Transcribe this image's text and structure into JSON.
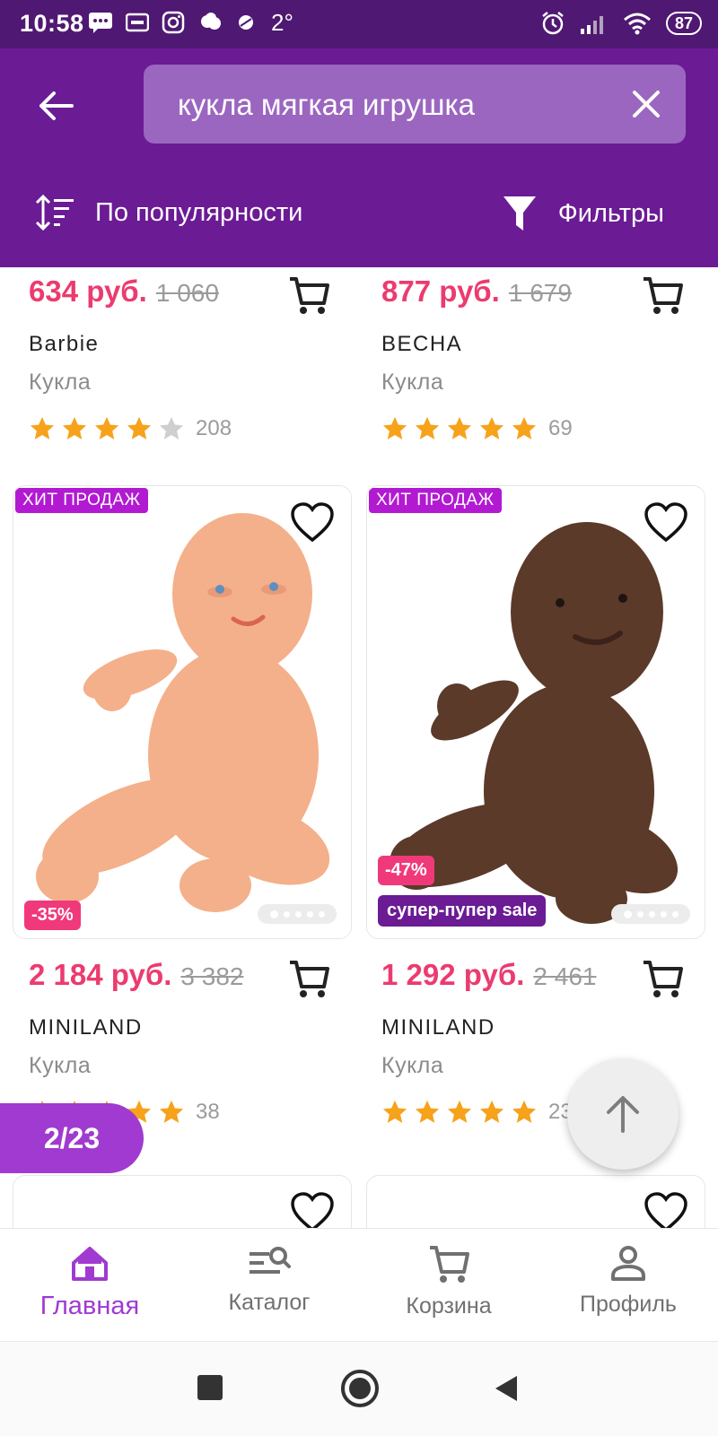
{
  "status_bar": {
    "time": "10:58",
    "temperature": "2°",
    "battery": "87",
    "icons": [
      "message-icon",
      "card-icon",
      "instagram-icon",
      "weather-icon",
      "dot-icon",
      "alarm-icon",
      "signal-icon",
      "wifi-icon"
    ]
  },
  "header": {
    "search": {
      "value": "кукла мягкая игрушка"
    },
    "sort_label": "По популярности",
    "filters_label": "Фильтры",
    "colors": {
      "header_bg": "#6b1b94",
      "status_bg": "#4f1872",
      "search_bg": "#9b66c0"
    }
  },
  "products_top": [
    {
      "price": "634 руб.",
      "old_price": "1 060",
      "brand": "Barbie",
      "type": "Кукла",
      "rating": 4,
      "reviews": "208"
    },
    {
      "price": "877 руб.",
      "old_price": "1 679",
      "brand": "ВЕСНА",
      "type": "Кукла",
      "rating": 5,
      "reviews": "69"
    }
  ],
  "products_main": [
    {
      "badge": "ХИТ ПРОДАЖ",
      "discount": "-35%",
      "promo": "",
      "price": "2 184 руб.",
      "old_price": "3 382",
      "brand": "MINILAND",
      "type": "Кукла",
      "rating": 5,
      "reviews": "38"
    },
    {
      "badge": "ХИТ ПРОДАЖ",
      "discount": "-47%",
      "promo": "супер-пупер sale",
      "price": "1 292 руб.",
      "old_price": "2 461",
      "brand": "MINILAND",
      "type": "Кукла",
      "rating": 5,
      "reviews": "23"
    }
  ],
  "pager": "2/23",
  "bottom_nav": [
    {
      "label": "Главная",
      "icon": "home-icon",
      "active": true
    },
    {
      "label": "Каталог",
      "icon": "catalog-search-icon",
      "active": false
    },
    {
      "label": "Корзина",
      "icon": "cart-icon",
      "active": false
    },
    {
      "label": "Профиль",
      "icon": "profile-icon",
      "active": false
    }
  ],
  "colors": {
    "price": "#ec3b6f",
    "star": "#f7a21b",
    "accent": "#a03ad0",
    "badge": "#b21ad2",
    "discount": "#f0397a"
  }
}
